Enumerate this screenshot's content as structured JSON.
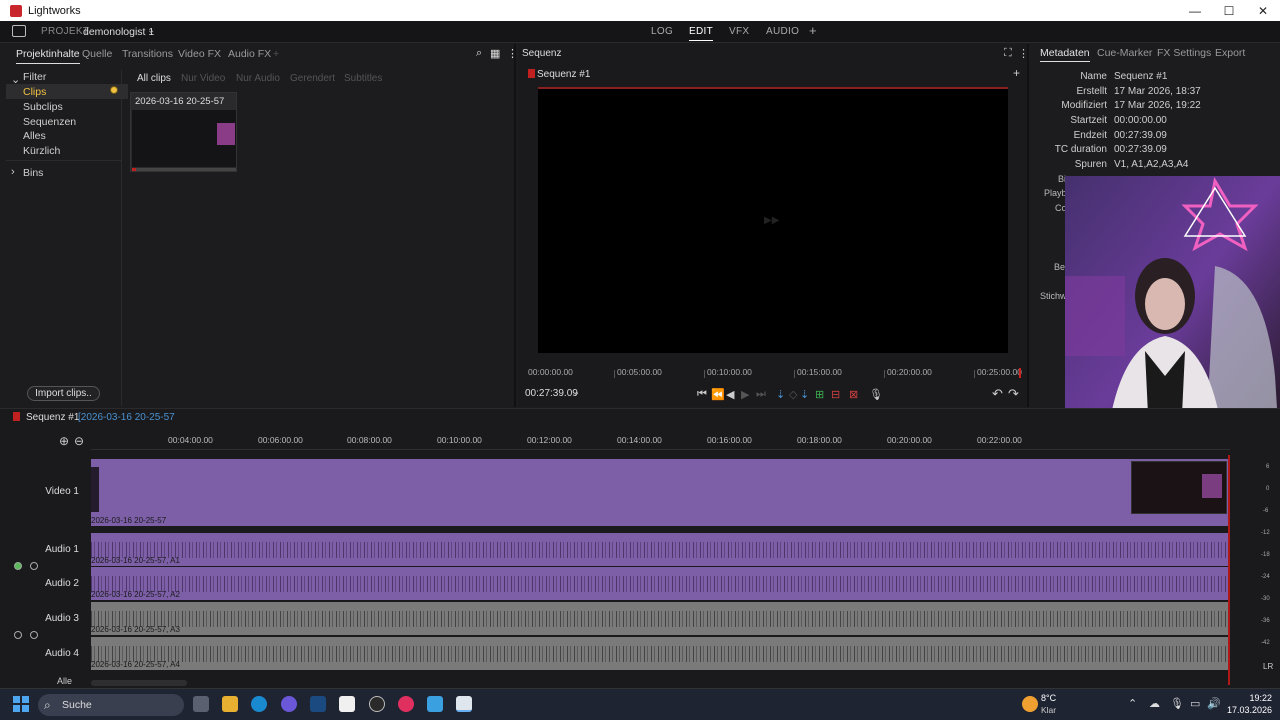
{
  "window": {
    "title": "Lightworks",
    "controls": [
      "—",
      "☐",
      "✕"
    ]
  },
  "project": {
    "label": "PROJEKT",
    "name": "demonologist 1"
  },
  "modes": [
    {
      "label": "LOG"
    },
    {
      "label": "EDIT"
    },
    {
      "label": "VFX"
    },
    {
      "label": "AUDIO"
    },
    {
      "label": "+"
    }
  ],
  "left_tabs": [
    "Projektinhalte",
    "Quelle",
    "Transitions",
    "Video FX",
    "Audio FX",
    "+"
  ],
  "filter": {
    "header": "Filter",
    "items": [
      "Clips",
      "Subclips",
      "Sequenzen",
      "Alles",
      "Kürzlich"
    ],
    "bins": "Bins"
  },
  "sub_tabs": [
    "All clips",
    "Nur Video",
    "Nur Audio",
    "Gerendert",
    "Subtitles"
  ],
  "clip": {
    "name": "2026-03-16 20-25-57"
  },
  "import_button": "Import clips..",
  "viewer": {
    "title": "Sequenz",
    "sequence": "Sequenz #1",
    "timecode": "00:27:39.09",
    "ruler": [
      "00:00:00.00",
      "00:05:00.00",
      "00:10:00.00",
      "00:15:00.00",
      "00:20:00.00",
      "00:25:00.00"
    ]
  },
  "meta_tabs": [
    "Metadaten",
    "Cue-Marker",
    "FX Settings",
    "Export"
  ],
  "metadata": [
    {
      "k": "Name",
      "v": "Sequenz #1"
    },
    {
      "k": "Erstellt",
      "v": "17 Mar 2026, 18:37"
    },
    {
      "k": "Modifiziert",
      "v": "17 Mar 2026, 19:22"
    },
    {
      "k": "Startzeit",
      "v": "00:00:00.00"
    },
    {
      "k": "Endzeit",
      "v": "00:27:39.09"
    },
    {
      "k": "TC duration",
      "v": "00:27:39.09"
    },
    {
      "k": "Spuren",
      "v": "V1, A1,A2,A3,A4"
    }
  ],
  "meta_cut": [
    "Bi",
    "Playb",
    "Co",
    "Be",
    "Stichw"
  ],
  "timeline": {
    "sequence": "Sequenz #1",
    "clip_ref": "[2026-03-16 20-25-57",
    "ruler": [
      "00:04:00.00",
      "00:06:00.00",
      "00:08:00.00",
      "00:10:00.00",
      "00:12:00.00",
      "00:14:00.00",
      "00:16:00.00",
      "00:18:00.00",
      "00:20:00.00",
      "00:22:00.00"
    ],
    "tracks": [
      {
        "label": "Video 1",
        "clip": "2026-03-16 20-25-57"
      },
      {
        "label": "Audio 1",
        "clip": "2026-03-16 20-25-57, A1"
      },
      {
        "label": "Audio 2",
        "clip": "2026-03-16 20-25-57, A2"
      },
      {
        "label": "Audio 3",
        "clip": "2026-03-16 20-25-57, A3"
      },
      {
        "label": "Audio 4",
        "clip": "2026-03-16 20-25-57, A4"
      }
    ],
    "all_label": "Alle",
    "meter_labels": [
      "6",
      "0",
      "-6",
      "-12",
      "-18",
      "-24",
      "-30",
      "-36",
      "-42"
    ],
    "lr": "LR"
  },
  "taskbar": {
    "search": "Suche",
    "weather_temp": "8°C",
    "weather_text": "Klar",
    "time": "19:22",
    "date": "17.03.2026"
  },
  "colors": {
    "accent": "#f0c040",
    "clip_purple": "#7c5fa6",
    "clip_gray": "#7a7a7a",
    "marker_red": "#c02020"
  }
}
